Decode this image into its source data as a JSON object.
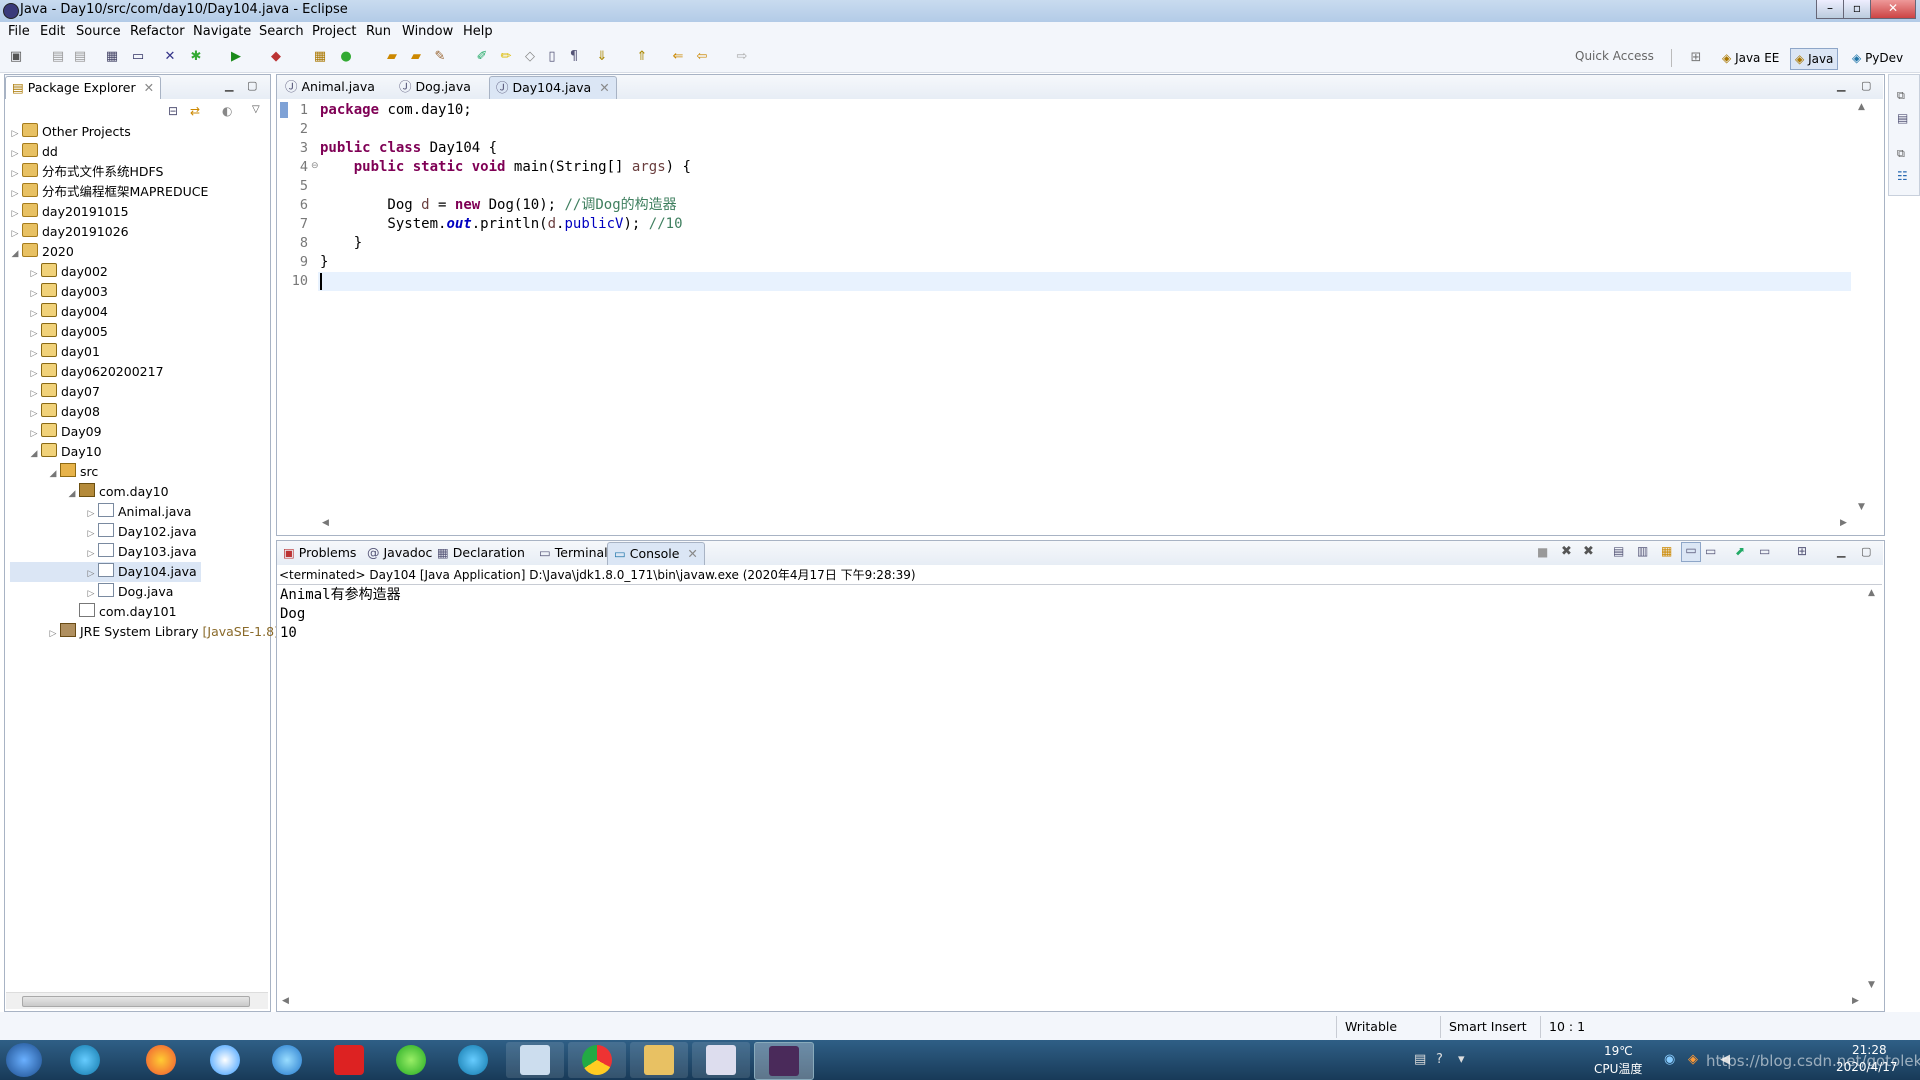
{
  "window": {
    "title": "Java - Day10/src/com/day10/Day104.java - Eclipse"
  },
  "menu": [
    "File",
    "Edit",
    "Source",
    "Refactor",
    "Navigate",
    "Search",
    "Project",
    "Run",
    "Window",
    "Help"
  ],
  "toolbar": {
    "quick_access": "Quick Access",
    "perspectives": [
      "Java EE",
      "Java",
      "PyDev"
    ]
  },
  "package_explorer": {
    "title": "Package Explorer",
    "tree": [
      {
        "label": "Other Projects",
        "depth": 0,
        "twisty": "▷",
        "icon": "i-proj"
      },
      {
        "label": "dd",
        "depth": 0,
        "twisty": "▷",
        "icon": "i-proj"
      },
      {
        "label": "分布式文件系统HDFS",
        "depth": 0,
        "twisty": "▷",
        "icon": "i-proj"
      },
      {
        "label": "分布式编程框架MAPREDUCE",
        "depth": 0,
        "twisty": "▷",
        "icon": "i-proj"
      },
      {
        "label": "day20191015",
        "depth": 0,
        "twisty": "▷",
        "icon": "i-proj"
      },
      {
        "label": "day20191026",
        "depth": 0,
        "twisty": "▷",
        "icon": "i-proj"
      },
      {
        "label": "2020",
        "depth": 0,
        "twisty": "◢",
        "icon": "i-proj"
      },
      {
        "label": "day002",
        "depth": 1,
        "twisty": "▷",
        "icon": "i-jproj"
      },
      {
        "label": "day003",
        "depth": 1,
        "twisty": "▷",
        "icon": "i-jproj"
      },
      {
        "label": "day004",
        "depth": 1,
        "twisty": "▷",
        "icon": "i-jproj"
      },
      {
        "label": "day005",
        "depth": 1,
        "twisty": "▷",
        "icon": "i-jproj"
      },
      {
        "label": "day01",
        "depth": 1,
        "twisty": "▷",
        "icon": "i-jproj"
      },
      {
        "label": "day0620200217",
        "depth": 1,
        "twisty": "▷",
        "icon": "i-jproj"
      },
      {
        "label": "day07",
        "depth": 1,
        "twisty": "▷",
        "icon": "i-jproj"
      },
      {
        "label": "day08",
        "depth": 1,
        "twisty": "▷",
        "icon": "i-jproj"
      },
      {
        "label": "Day09",
        "depth": 1,
        "twisty": "▷",
        "icon": "i-jproj"
      },
      {
        "label": "Day10",
        "depth": 1,
        "twisty": "◢",
        "icon": "i-jproj"
      },
      {
        "label": "src",
        "depth": 2,
        "twisty": "◢",
        "icon": "i-src"
      },
      {
        "label": "com.day10",
        "depth": 3,
        "twisty": "◢",
        "icon": "i-pkg"
      },
      {
        "label": "Animal.java",
        "depth": 4,
        "twisty": "▷",
        "icon": "i-java"
      },
      {
        "label": "Day102.java",
        "depth": 4,
        "twisty": "▷",
        "icon": "i-java"
      },
      {
        "label": "Day103.java",
        "depth": 4,
        "twisty": "▷",
        "icon": "i-java"
      },
      {
        "label": "Day104.java",
        "depth": 4,
        "twisty": "▷",
        "icon": "i-java",
        "selected": true
      },
      {
        "label": "Dog.java",
        "depth": 4,
        "twisty": "▷",
        "icon": "i-java"
      },
      {
        "label": "com.day101",
        "depth": 3,
        "twisty": "",
        "icon": "i-pkg2"
      },
      {
        "label": "JRE System Library",
        "depth": 2,
        "twisty": "▷",
        "icon": "i-jre",
        "decoration": " [JavaSE-1.8]"
      }
    ]
  },
  "editor": {
    "tabs": [
      {
        "label": "Animal.java",
        "active": false
      },
      {
        "label": "Dog.java",
        "active": false
      },
      {
        "label": "Day104.java",
        "active": true
      }
    ],
    "line_numbers": [
      "1",
      "2",
      "3",
      "4",
      "5",
      "6",
      "7",
      "8",
      "9",
      "10"
    ],
    "code": [
      [
        {
          "t": "package",
          "c": "kw"
        },
        {
          "t": " com.day10;"
        }
      ],
      [],
      [
        {
          "t": "public",
          "c": "kw"
        },
        {
          "t": " "
        },
        {
          "t": "class",
          "c": "kw"
        },
        {
          "t": " Day104 {"
        }
      ],
      [
        {
          "t": "    "
        },
        {
          "t": "public",
          "c": "kw"
        },
        {
          "t": " "
        },
        {
          "t": "static",
          "c": "kw"
        },
        {
          "t": " "
        },
        {
          "t": "void",
          "c": "kw"
        },
        {
          "t": " main(String[] "
        },
        {
          "t": "args",
          "c": "prm"
        },
        {
          "t": ") {"
        }
      ],
      [],
      [
        {
          "t": "        Dog "
        },
        {
          "t": "d",
          "c": "prm"
        },
        {
          "t": " = "
        },
        {
          "t": "new",
          "c": "kw"
        },
        {
          "t": " Dog(10); "
        },
        {
          "t": "//调Dog的构造器",
          "c": "cm"
        }
      ],
      [
        {
          "t": "        System."
        },
        {
          "t": "out",
          "c": "sfld"
        },
        {
          "t": ".println("
        },
        {
          "t": "d",
          "c": "prm"
        },
        {
          "t": "."
        },
        {
          "t": "publicV",
          "c": "fld"
        },
        {
          "t": "); "
        },
        {
          "t": "//10",
          "c": "cm"
        }
      ],
      [
        {
          "t": "    }"
        }
      ],
      [
        {
          "t": "}"
        }
      ],
      []
    ]
  },
  "bottom_views": {
    "tabs": [
      {
        "label": "Problems",
        "icon": "problems-icon"
      },
      {
        "label": "Javadoc",
        "icon": "javadoc-icon"
      },
      {
        "label": "Declaration",
        "icon": "declaration-icon"
      },
      {
        "label": "Terminal",
        "icon": "terminal-icon"
      },
      {
        "label": "Console",
        "icon": "console-icon",
        "active": true
      }
    ],
    "console_header": "<terminated> Day104 [Java Application] D:\\Java\\jdk1.8.0_171\\bin\\javaw.exe (2020年4月17日 下午9:28:39)",
    "console_output": [
      "Animal有参构造器",
      "Dog",
      "10"
    ]
  },
  "status": {
    "writable": "Writable",
    "insert_mode": "Smart Insert",
    "position": "10 : 1"
  },
  "taskbar": {
    "temperature": "19℃",
    "cpu_label": "CPU温度",
    "time": "21:28",
    "date": "2020/4/17",
    "watermark": "https://blog.csdn.net/gotoleko"
  }
}
